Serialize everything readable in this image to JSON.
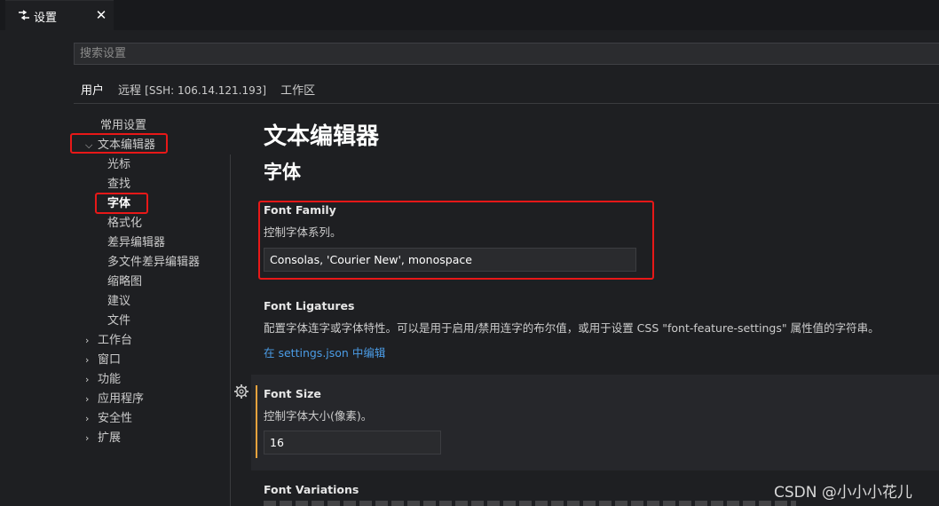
{
  "tab": {
    "label": "设置",
    "close_glyph": "✕",
    "icon": "settings-sliders-icon"
  },
  "search": {
    "placeholder": "搜索设置",
    "value": ""
  },
  "scope_tabs": [
    {
      "label": "用户",
      "active": true
    },
    {
      "label": "远程",
      "extra": "[SSH: 106.14.121.193]",
      "active": false
    },
    {
      "label": "工作区",
      "active": false
    }
  ],
  "toc": {
    "common": "常用设置",
    "text_editor": "文本编辑器",
    "text_editor_children": [
      "光标",
      "查找",
      "字体",
      "格式化",
      "差异编辑器",
      "多文件差异编辑器",
      "缩略图",
      "建议",
      "文件"
    ],
    "collapsed": [
      "工作台",
      "窗口",
      "功能",
      "应用程序",
      "安全性",
      "扩展"
    ]
  },
  "main": {
    "heading": "文本编辑器",
    "subheading": "字体",
    "font_family": {
      "title": "Font Family",
      "description": "控制字体系列。",
      "value": "Consolas, 'Courier New', monospace"
    },
    "font_ligatures": {
      "title": "Font Ligatures",
      "description": "配置字体连字或字体特性。可以是用于启用/禁用连字的布尔值，或用于设置 CSS \"font-feature-settings\" 属性值的字符串。",
      "link": "在 settings.json 中编辑"
    },
    "font_size": {
      "title": "Font Size",
      "description": "控制字体大小(像素)。",
      "value": "16"
    },
    "font_variations": {
      "title": "Font Variations"
    }
  },
  "watermark": "CSDN @小小小花儿",
  "colors": {
    "highlight": "#e81818",
    "focus": "#e8a33d",
    "link": "#4b9ce6"
  }
}
